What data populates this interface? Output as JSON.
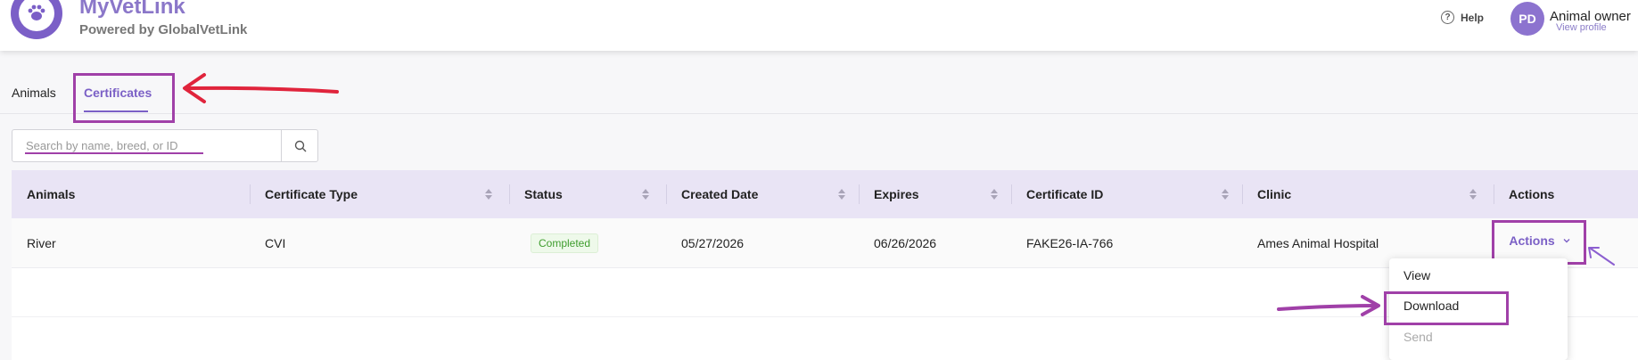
{
  "header": {
    "brand_title": "MyVetLink",
    "brand_subtitle": "Powered by GlobalVetLink",
    "help_label": "Help",
    "user_initials": "PD",
    "user_name": "Animal owner",
    "user_link": "View profile"
  },
  "tabs": [
    {
      "label": "Animals",
      "active": false
    },
    {
      "label": "Certificates",
      "active": true
    }
  ],
  "search": {
    "placeholder": "Search by name, breed, or ID",
    "value": ""
  },
  "table": {
    "columns": [
      "Animals",
      "Certificate Type",
      "Status",
      "Created Date",
      "Expires",
      "Certificate ID",
      "Clinic",
      "Actions"
    ],
    "rows": [
      {
        "animal": "River",
        "certificate_type": "CVI",
        "status": "Completed",
        "created_date": "05/27/2026",
        "expires": "06/26/2026",
        "certificate_id": "FAKE26-IA-766",
        "clinic": "Ames Animal Hospital",
        "actions_label": "Actions"
      }
    ]
  },
  "actions_menu": {
    "items": [
      {
        "label": "View",
        "enabled": true
      },
      {
        "label": "Download",
        "enabled": true
      },
      {
        "label": "Send",
        "enabled": false
      }
    ]
  },
  "colors": {
    "brand": "#7b60c6",
    "header_row": "#e9e4f5",
    "highlight": "#a040a8",
    "arrow_red": "#e0243c",
    "status_green": "#3f9d2e"
  }
}
